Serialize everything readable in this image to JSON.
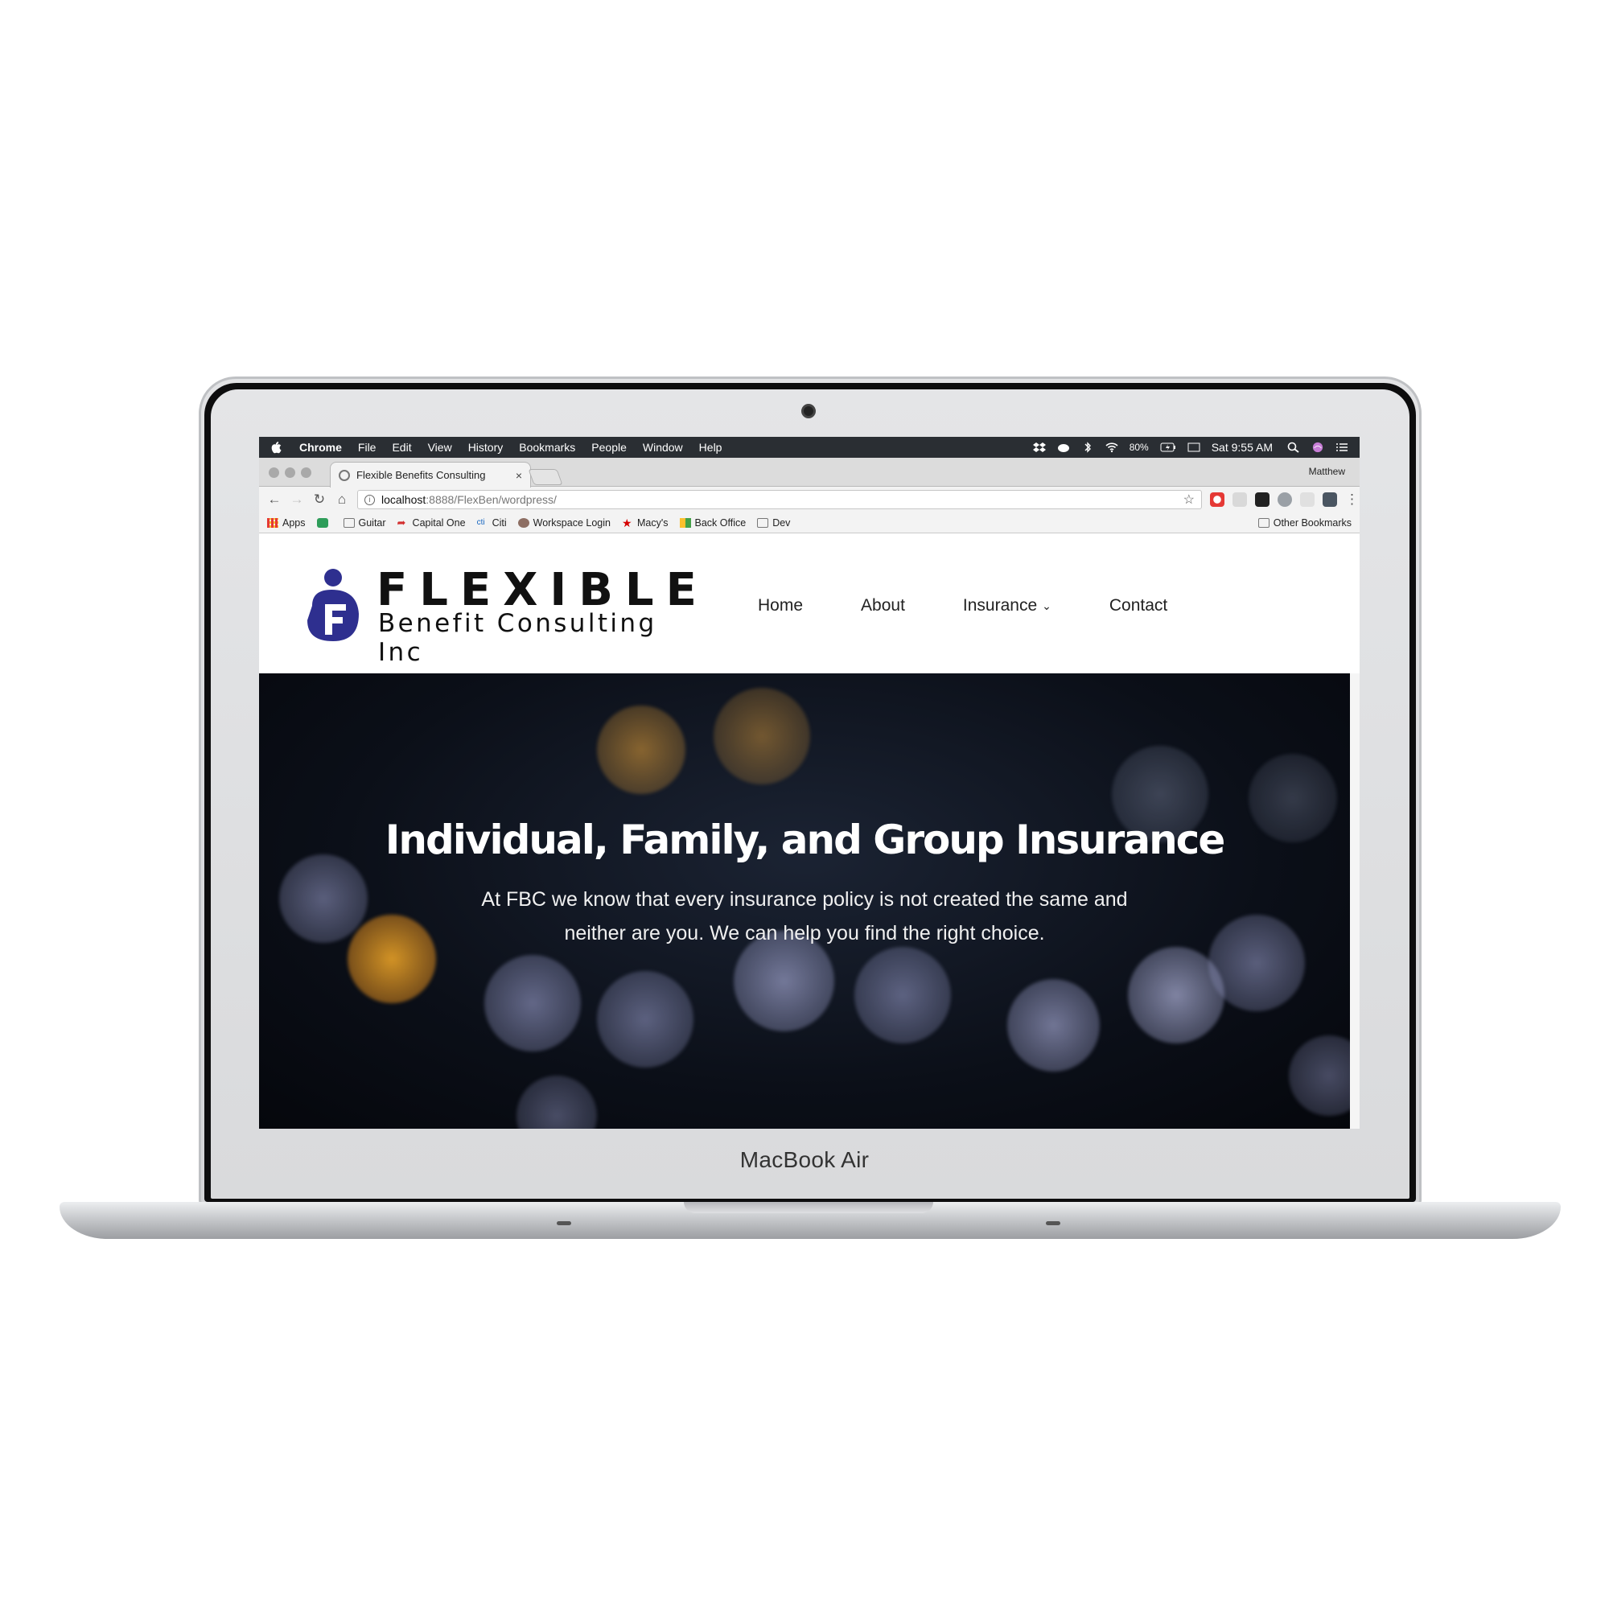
{
  "device": {
    "brand_label": "MacBook Air"
  },
  "menubar": {
    "app_name": "Chrome",
    "menus": [
      "File",
      "Edit",
      "View",
      "History",
      "Bookmarks",
      "People",
      "Window",
      "Help"
    ],
    "battery": "80%",
    "clock": "Sat 9:55 AM"
  },
  "browser": {
    "tab_title": "Flexible Benefits Consulting",
    "tab_close": "×",
    "profile_name": "Matthew",
    "url_host": "localhost",
    "url_path": ":8888/FlexBen/wordpress/",
    "bookmarks": [
      {
        "label": "Apps",
        "icon": "apps-grid-icon"
      },
      {
        "label": "",
        "icon": "green-app-icon"
      },
      {
        "label": "Guitar",
        "icon": "folder-icon"
      },
      {
        "label": "Capital One",
        "icon": "capital-one-icon"
      },
      {
        "label": "Citi",
        "icon": "citi-icon"
      },
      {
        "label": "Workspace Login",
        "icon": "workspace-icon"
      },
      {
        "label": "Macy's",
        "icon": "star-icon"
      },
      {
        "label": "Back Office",
        "icon": "back-office-icon"
      },
      {
        "label": "Dev",
        "icon": "folder-icon"
      }
    ],
    "other_bookmarks": "Other Bookmarks"
  },
  "site": {
    "logo": {
      "word1": "FLEXIBLE",
      "word2": "Benefit Consulting Inc",
      "mark_letter": "F"
    },
    "nav": {
      "home": "Home",
      "about": "About",
      "insurance": "Insurance",
      "contact": "Contact"
    },
    "hero": {
      "title": "Individual, Family, and Group Insurance",
      "subtitle": "At FBC we know that every insurance policy is not created the same and neither are you. We can help you find the right choice."
    }
  },
  "colors": {
    "menubar_bg": "#2a2e33",
    "logo_blue": "#2e2f8f",
    "hero_bg": "#0b0f18",
    "bokeh_orange": "#e8a33a",
    "bokeh_lavender": "#a9aee0"
  }
}
